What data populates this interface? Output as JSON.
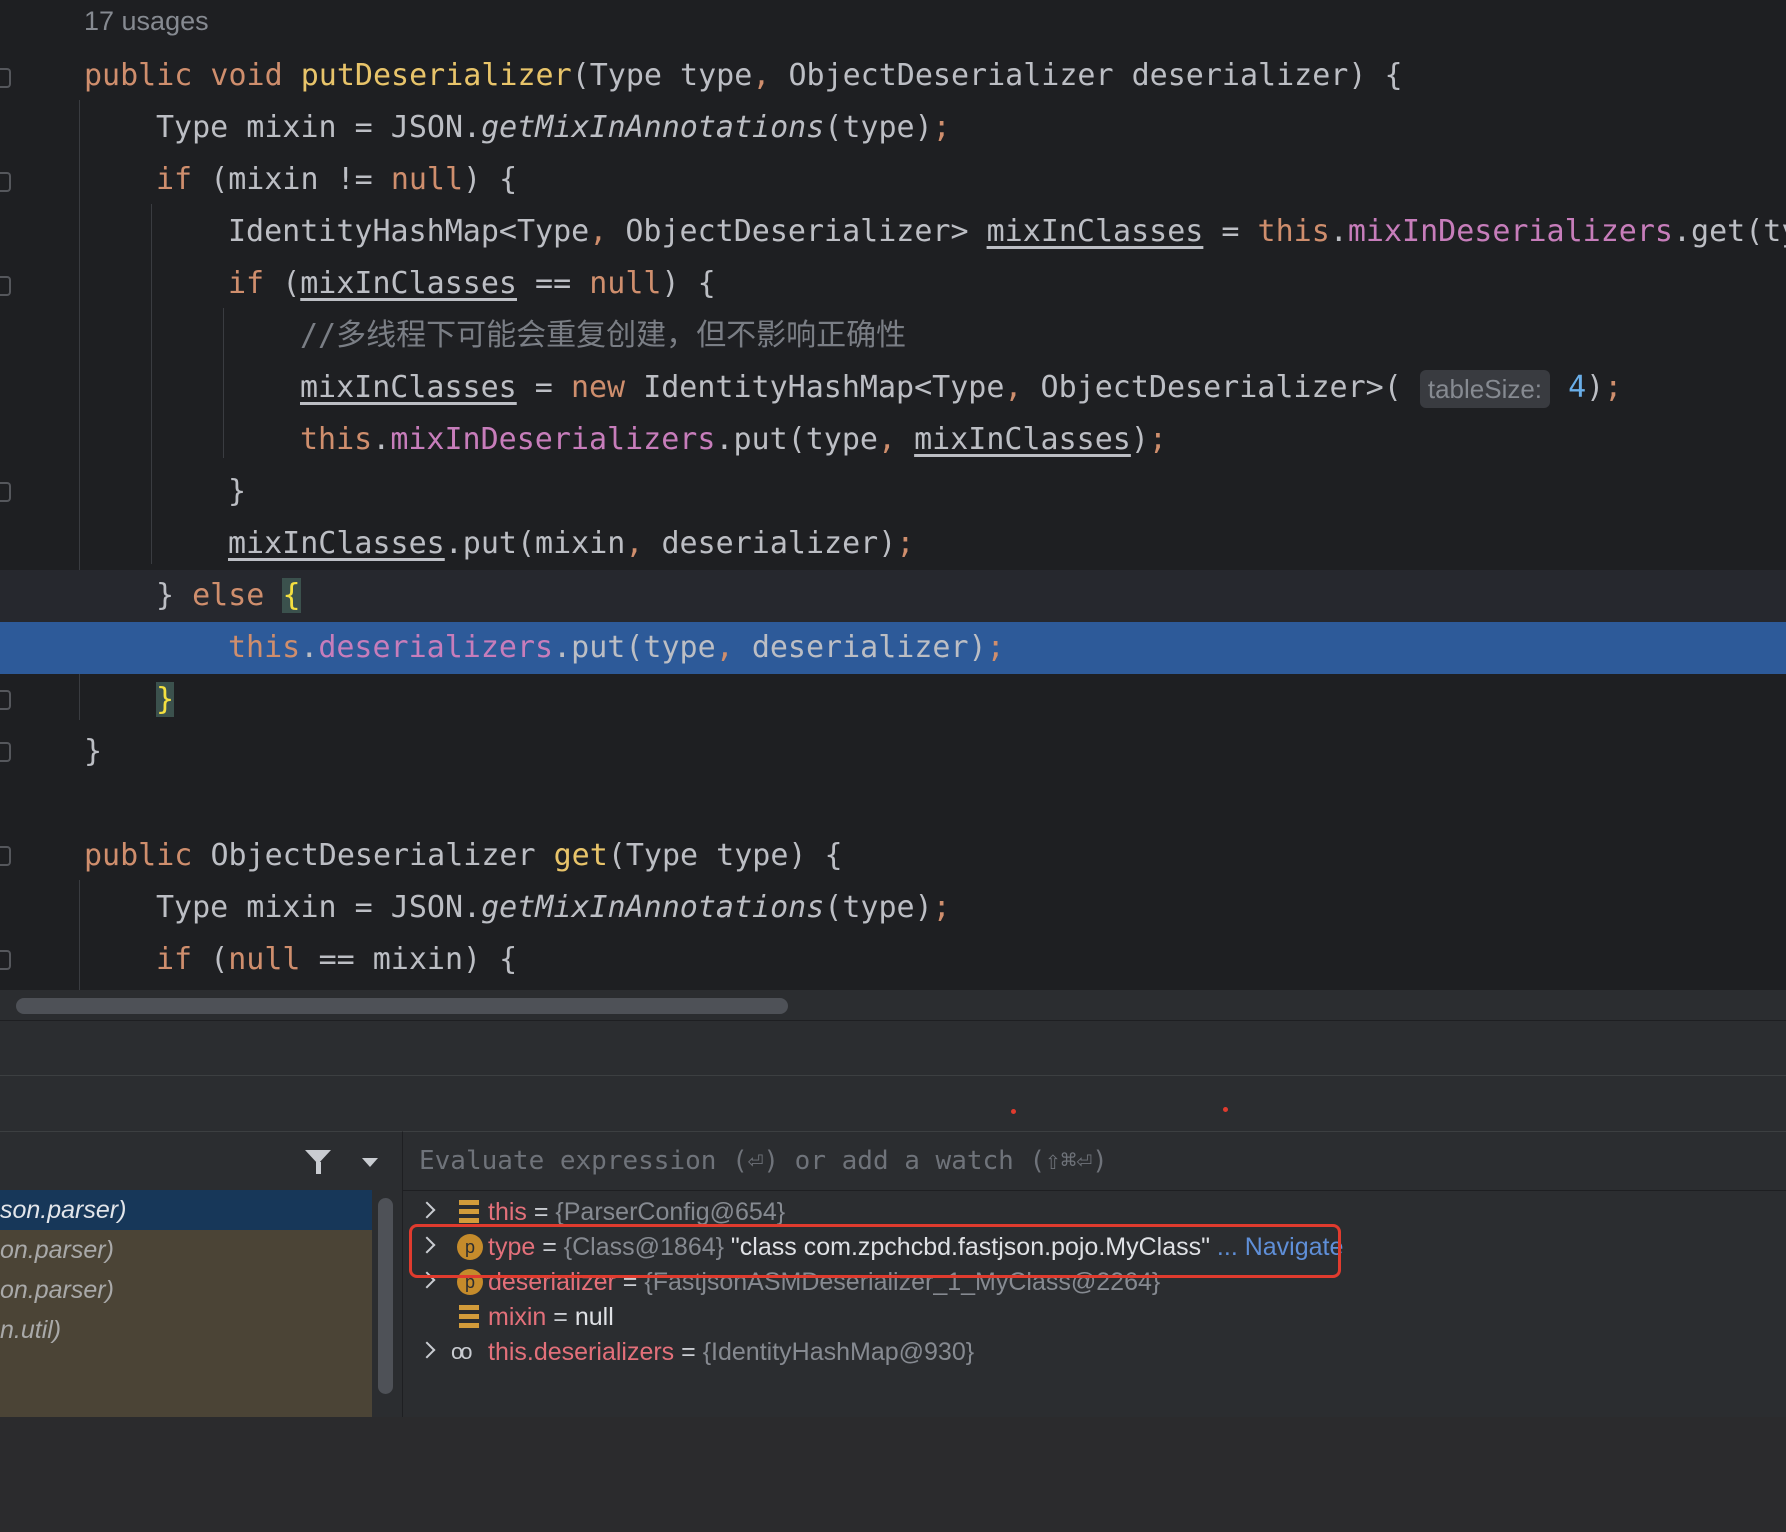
{
  "editor": {
    "usages": "17 usages",
    "hint_table_size": "tableSize:"
  },
  "frames": [
    {
      "text": "son.parser)",
      "selected": true
    },
    {
      "text": "on.parser)",
      "selected": false
    },
    {
      "text": "on.parser)",
      "selected": false
    },
    {
      "text": "n.util)",
      "selected": false
    }
  ],
  "evaluate": {
    "placeholder": "Evaluate expression (⏎) or add a watch (⇧⌘⏎)"
  },
  "variables": [
    {
      "name": "this",
      "eq": " = ",
      "type": "{ParserConfig@654}",
      "value": "",
      "extra": "",
      "expandable": true,
      "icon": "field-icon"
    },
    {
      "name": "type",
      "eq": " = ",
      "type": "{Class@1864}",
      "value": " \"class com.zpchcbd.fastjson.pojo.MyClass\"",
      "extra": " ... Navigate",
      "expandable": true,
      "icon": "parameter-icon"
    },
    {
      "name": "deserializer",
      "eq": " = ",
      "type": "{FastjsonASMDeserializer_1_MyClass@2264}",
      "value": "",
      "extra": "",
      "expandable": true,
      "icon": "parameter-icon"
    },
    {
      "name": "mixin",
      "eq": " = ",
      "type": "",
      "value": "null",
      "extra": "",
      "expandable": false,
      "icon": "field-icon"
    },
    {
      "name": "this.deserializers",
      "eq": " = ",
      "type": "{IdentityHashMap@930}",
      "value": "",
      "extra": "",
      "expandable": true,
      "icon": "watch-icon"
    }
  ],
  "colors": {
    "highlight_box": "#e03b2e",
    "execution_line": "#2d5a99"
  }
}
